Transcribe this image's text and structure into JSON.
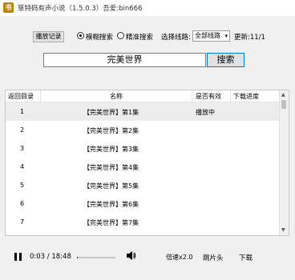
{
  "window": {
    "icon_text": "书",
    "title": "草特码有声小说（1.5.0.3）吾爱:bin666"
  },
  "toolbar": {
    "history_label": "播放记录",
    "fuzzy_label": "模糊搜索",
    "exact_label": "精准搜索",
    "line_label": "选择线路:",
    "line_value": "全部线路",
    "update_label": "更新:11/1"
  },
  "search": {
    "query": "完美世界",
    "button_label": "搜索"
  },
  "table": {
    "headers": {
      "back": "返回目录",
      "name": "名称",
      "valid": "是否有效",
      "download": "下载进度"
    },
    "rows": [
      {
        "index": "1",
        "name": "【完美世界】第1集",
        "status": "播放中"
      },
      {
        "index": "2",
        "name": "【完美世界】第2集",
        "status": ""
      },
      {
        "index": "3",
        "name": "【完美世界】第3集",
        "status": ""
      },
      {
        "index": "4",
        "name": "【完美世界】第4集",
        "status": ""
      },
      {
        "index": "5",
        "name": "【完美世界】第5集",
        "status": ""
      },
      {
        "index": "6",
        "name": "【完美世界】第6集",
        "status": ""
      },
      {
        "index": "7",
        "name": "【完美世界】第7集",
        "status": ""
      }
    ]
  },
  "player": {
    "time_text": "0:03 / 18:48",
    "progress": 0.003,
    "speed_label": "倍速x2.0",
    "skip_label": "跳片头",
    "download_label": "下载"
  },
  "colors": {
    "app_icon": "#b8860b",
    "selected_row": "#ececec",
    "button_focus": "#0078d7"
  },
  "icons": {
    "play": "pause-icon",
    "volume": "volume-icon"
  }
}
